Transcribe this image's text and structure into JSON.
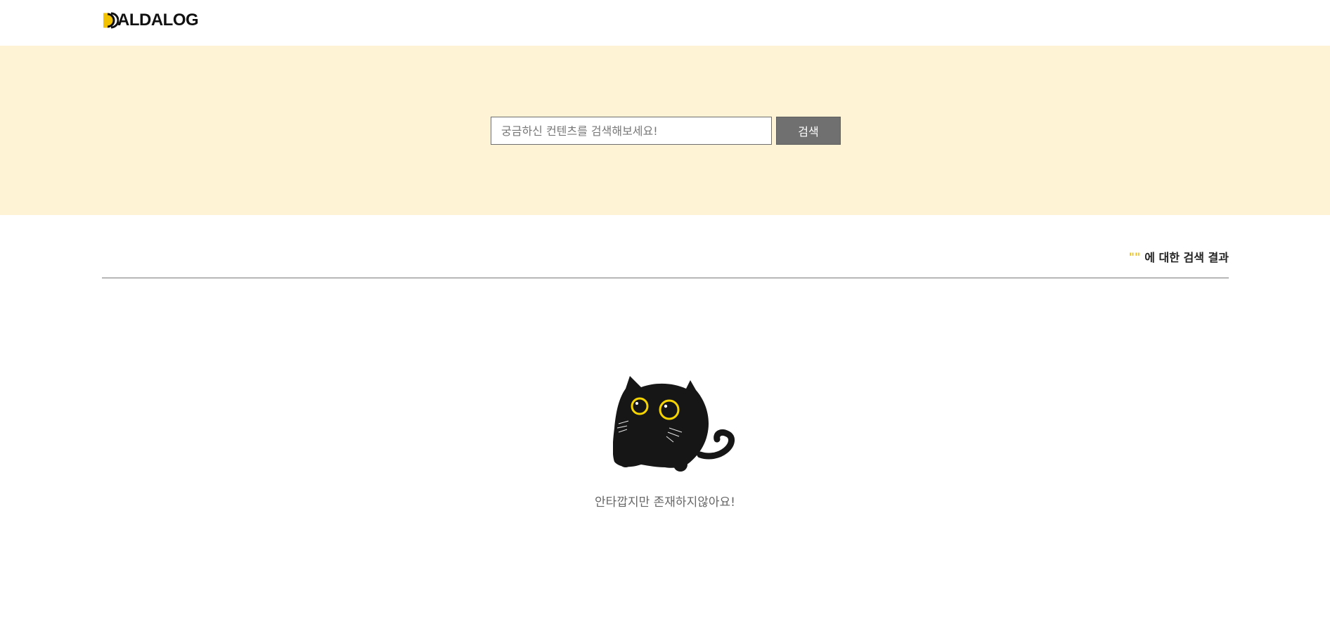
{
  "header": {
    "logo_text": "ALDALOG",
    "logo_mark": "moon-d-mark",
    "accent_color": "#f2c200"
  },
  "search": {
    "placeholder": "궁금하신 컨텐츠를 검색해보세요!",
    "value": "",
    "button_label": "검색"
  },
  "results": {
    "query_display": "\"\"",
    "heading_suffix": "에 대한 검색 결과"
  },
  "empty_state": {
    "illustration": "black-cat",
    "message": "안타깝지만 존재하지않아요!"
  },
  "colors": {
    "hero_background": "#fff3d6",
    "search_button": "#707070",
    "query_accent": "#f0c020",
    "cat_eye": "#f5d400"
  }
}
